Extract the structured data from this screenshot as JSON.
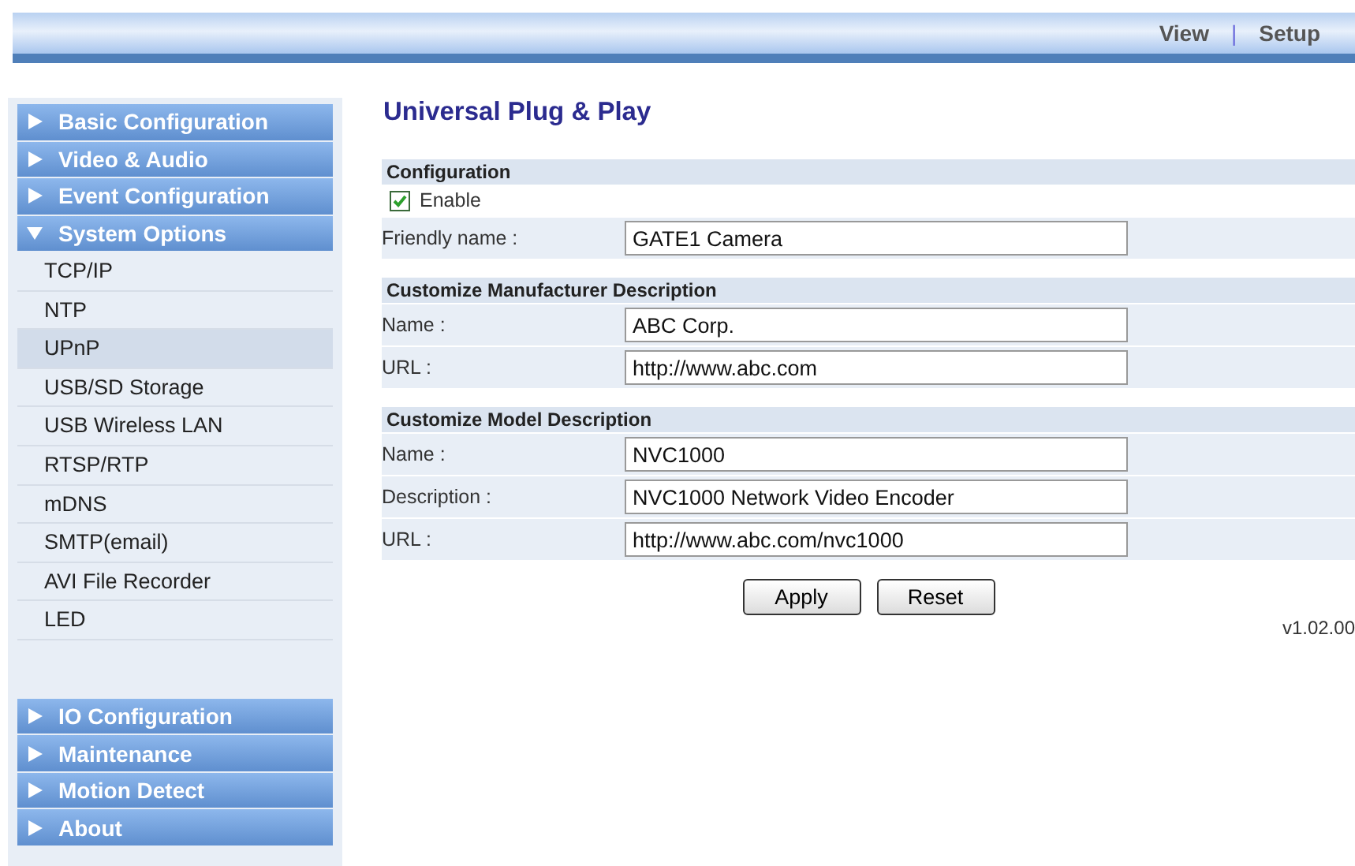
{
  "top_nav": {
    "links": [
      {
        "label": "View"
      },
      {
        "label": "Setup"
      }
    ],
    "separator": "|"
  },
  "sidebar": {
    "groups": [
      {
        "label": "Basic Configuration",
        "expanded": false
      },
      {
        "label": "Video & Audio",
        "expanded": false
      },
      {
        "label": "Event Configuration",
        "expanded": false
      },
      {
        "label": "System Options",
        "expanded": true,
        "items": [
          {
            "label": "TCP/IP",
            "selected": false
          },
          {
            "label": "NTP",
            "selected": false
          },
          {
            "label": "UPnP",
            "selected": true
          },
          {
            "label": "USB/SD Storage",
            "selected": false
          },
          {
            "label": "USB Wireless LAN",
            "selected": false
          },
          {
            "label": "RTSP/RTP",
            "selected": false
          },
          {
            "label": "mDNS",
            "selected": false
          },
          {
            "label": "SMTP(email)",
            "selected": false
          },
          {
            "label": "AVI File Recorder",
            "selected": false
          },
          {
            "label": "LED",
            "selected": false
          }
        ]
      }
    ],
    "bottom_groups": [
      {
        "label": "IO Configuration",
        "expanded": false
      },
      {
        "label": "Maintenance",
        "expanded": false
      },
      {
        "label": "Motion Detect",
        "expanded": false
      },
      {
        "label": "About",
        "expanded": false
      }
    ]
  },
  "page": {
    "title": "Universal Plug & Play",
    "sections": [
      {
        "heading": "Configuration",
        "rows": [
          {
            "kind": "checkbox",
            "label": "Enable",
            "checked": true
          },
          {
            "kind": "text",
            "label": "Friendly name :",
            "value": "GATE1 Camera"
          }
        ]
      },
      {
        "heading": "Customize Manufacturer Description",
        "rows": [
          {
            "kind": "text",
            "label": "Name :",
            "value": "ABC Corp."
          },
          {
            "kind": "text",
            "label": "URL :",
            "value": "http://www.abc.com"
          }
        ]
      },
      {
        "heading": "Customize Model Description",
        "rows": [
          {
            "kind": "text",
            "label": "Name :",
            "value": "NVC1000"
          },
          {
            "kind": "text",
            "label": "Description :",
            "value": "NVC1000 Network Video Encoder"
          },
          {
            "kind": "text",
            "label": "URL :",
            "value": "http://www.abc.com/nvc1000"
          }
        ]
      }
    ],
    "buttons": [
      {
        "label": "Apply"
      },
      {
        "label": "Reset"
      }
    ],
    "version": "v1.02.00"
  }
}
